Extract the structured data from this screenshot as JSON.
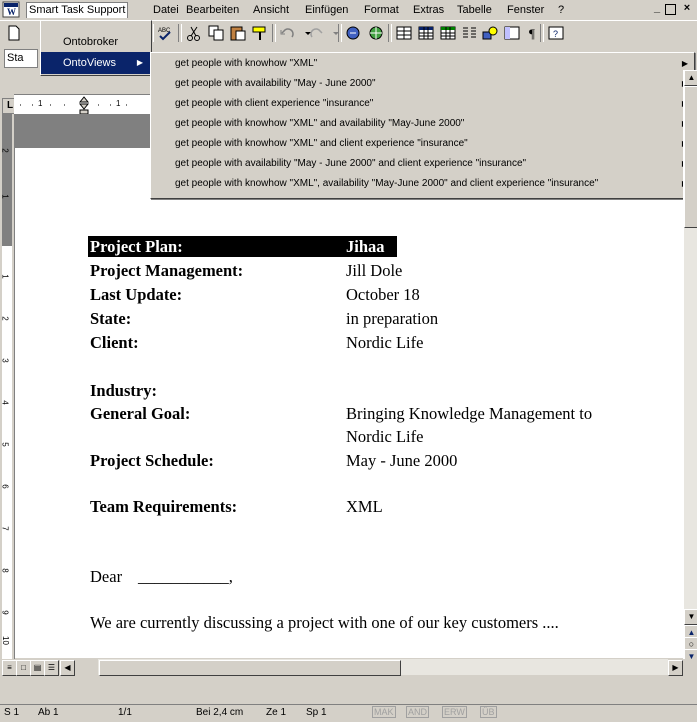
{
  "menubar": {
    "items": [
      "Smart Task Support",
      "Datei",
      "Bearbeiten",
      "Ansicht",
      "Einfügen",
      "Format",
      "Extras",
      "Tabelle",
      "Fenster",
      "?"
    ],
    "window_controls": [
      "_",
      "⬜",
      "×"
    ]
  },
  "toolbar": {
    "style_box": "Sta",
    "ruler_numbers": [
      "1",
      "1"
    ]
  },
  "dropdown": {
    "items": [
      {
        "label": "Ontobroker",
        "has_submenu": false
      },
      {
        "label": "OntoViews",
        "has_submenu": true
      }
    ]
  },
  "submenu": {
    "items": [
      "get people with knowhow \"XML\"",
      "get people with availability \"May - June 2000\"",
      "get people with client experience \"insurance\"",
      "get people with knowhow \"XML\" and availability \"May-June 2000\"",
      "get people with knowhow \"XML\" and client experience \"insurance\"",
      "get people with availability \"May - June 2000\" and client experience \"insurance\"",
      "get people with knowhow \"XML\", availability \"May-June 2000\" and client experience \"insurance\""
    ]
  },
  "document": {
    "project_plan": {
      "label": "Project Plan:",
      "value": "Jihaa"
    },
    "project_management": {
      "label": "Project Management:",
      "value": "Jill Dole"
    },
    "last_update": {
      "label": "Last Update:",
      "value": "October 18"
    },
    "state": {
      "label": "State:",
      "value": "in preparation"
    },
    "client": {
      "label": "Client:",
      "value": "Nordic Life"
    },
    "industry": {
      "label": "Industry:",
      "value": ""
    },
    "general_goal": {
      "label": "General Goal:",
      "value_line1": "Bringing Knowledge Management to",
      "value_line2": "Nordic Life"
    },
    "project_schedule": {
      "label": "Project Schedule:",
      "value": "May - June 2000"
    },
    "team_requirements": {
      "label": "Team Requirements:",
      "value": "XML"
    },
    "salutation": "Dear",
    "salutation_blank": "___________,",
    "body": "We are currently discussing a project with one of our key customers ...."
  },
  "vruler_numbers": [
    "2",
    "1",
    "1",
    "2",
    "3",
    "4",
    "5",
    "6",
    "7",
    "8",
    "9",
    "10"
  ],
  "statusbar": {
    "section": "S 1",
    "page": "Ab 1",
    "pages": "1/1",
    "position": "Bei 2,4 cm",
    "line": "Ze 1",
    "column": "Sp 1",
    "indicators": [
      "MAK",
      "AND",
      "ERW",
      "ÜB"
    ]
  },
  "colors": {
    "highlight": "#0a246a",
    "chrome": "#d4d0c8"
  }
}
